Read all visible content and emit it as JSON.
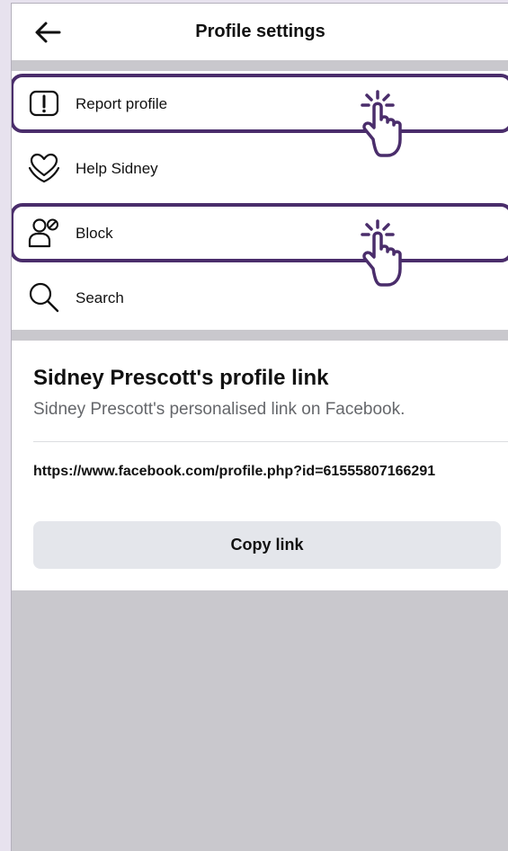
{
  "header": {
    "title": "Profile settings",
    "back_icon": "back-arrow-icon"
  },
  "menu": {
    "items": [
      {
        "label": "Report profile",
        "icon": "report-icon",
        "highlighted": true
      },
      {
        "label": "Help Sidney",
        "icon": "heart-hands-icon",
        "highlighted": false
      },
      {
        "label": "Block",
        "icon": "block-user-icon",
        "highlighted": true
      },
      {
        "label": "Search",
        "icon": "search-icon",
        "highlighted": false
      }
    ]
  },
  "profile_link": {
    "title": "Sidney Prescott's profile link",
    "subtitle": "Sidney Prescott's personalised link on Facebook.",
    "url": "https://www.facebook.com/profile.php?id=61555807166291",
    "copy_label": "Copy link"
  },
  "colors": {
    "highlight": "#4a2d6b",
    "background": "#c9c8cd",
    "button": "#e4e6eb"
  }
}
